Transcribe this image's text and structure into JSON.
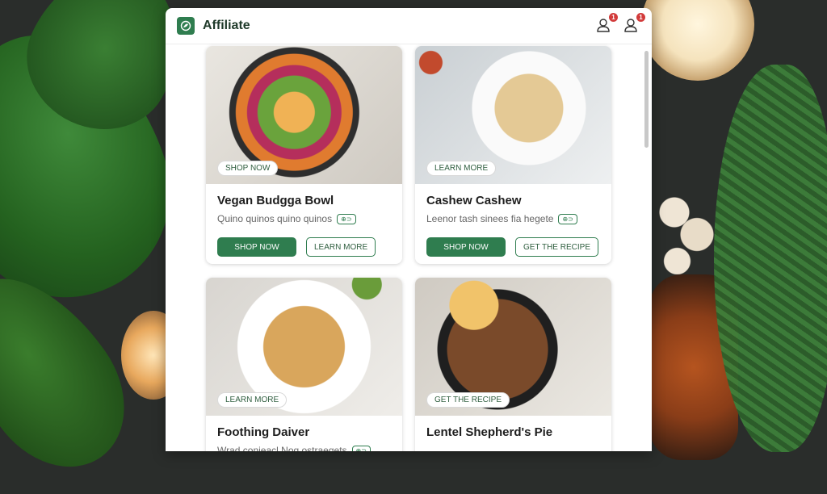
{
  "app": {
    "title": "Affiliate",
    "notification_count_1": "1",
    "notification_count_2": "1"
  },
  "cards": [
    {
      "image_tag": "SHOP NOW",
      "title": "Vegan Budgga Bowl",
      "description": "Quino quinos quino quinos",
      "description_icon": "⊕⊃",
      "primary_button": "SHOP NOW",
      "secondary_button": "LEARN MORE"
    },
    {
      "image_tag": "LEARN MORE",
      "title": "Cashew Cashew",
      "description": "Leenor tash sinees fia hegete",
      "description_icon": "⊕⊃",
      "primary_button": "SHOP NOW",
      "secondary_button": "GET THE RECIPE"
    },
    {
      "image_tag": "LEARN MORE",
      "title": "Foothing Daiver",
      "description": "Wrad conieacl Nog ostraegets",
      "description_icon": "⊕⊃"
    },
    {
      "image_tag": "GET THE RECIPE",
      "title": "Lentel Shepherd's Pie"
    }
  ],
  "colors": {
    "accent": "#2f7d4f",
    "badge": "#d23b3b"
  },
  "icons": {
    "logo": "leaf-logo-icon",
    "user": "user-icon"
  }
}
